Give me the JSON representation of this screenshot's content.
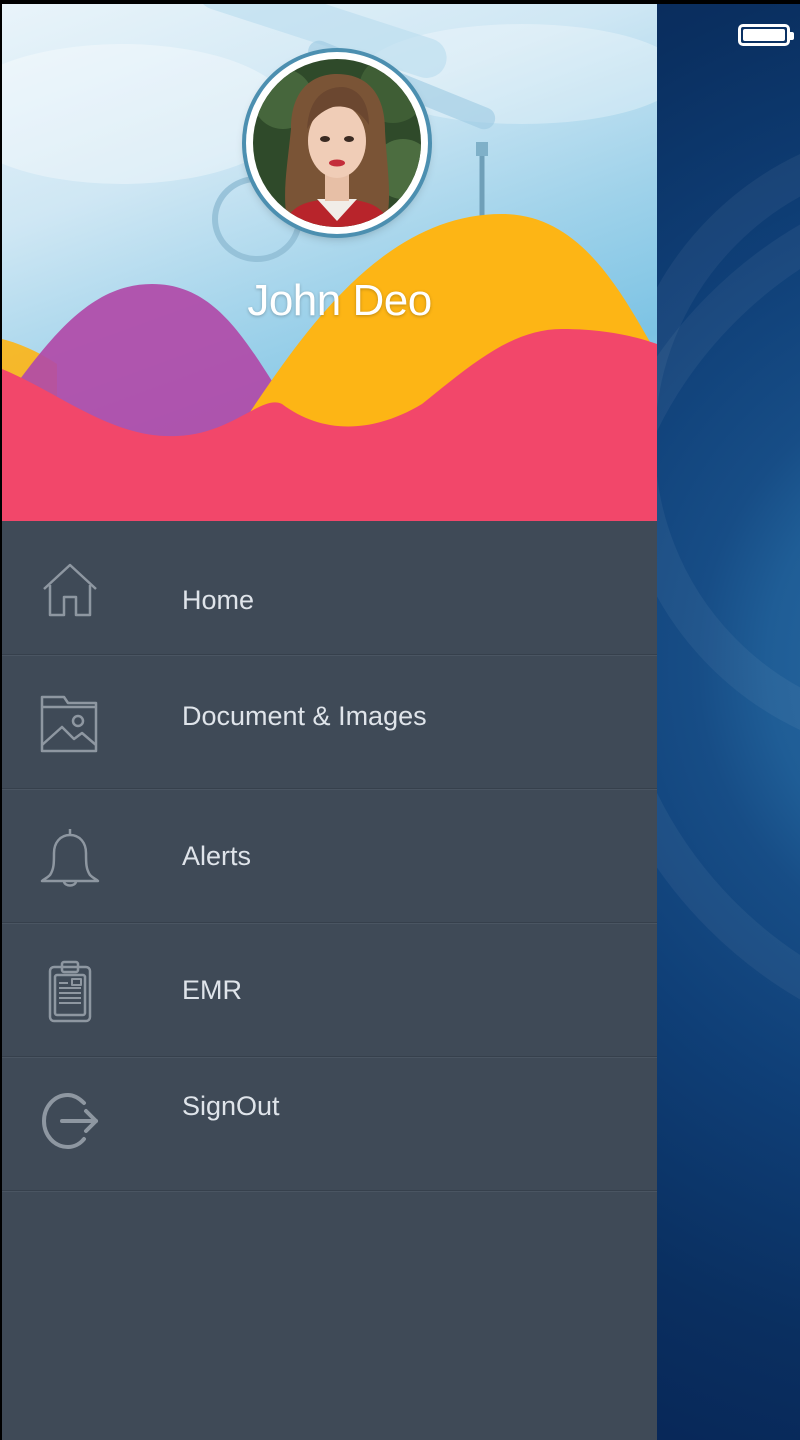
{
  "profile": {
    "name": "John Deo"
  },
  "menu": {
    "items": [
      {
        "label": "Home",
        "icon": "home-icon"
      },
      {
        "label": "Document & Images",
        "icon": "folder-image-icon"
      },
      {
        "label": "Alerts",
        "icon": "bell-icon"
      },
      {
        "label": "EMR",
        "icon": "clipboard-icon"
      },
      {
        "label": "SignOut",
        "icon": "signout-icon"
      }
    ]
  },
  "colors": {
    "drawer_bg": "#3f4a57",
    "wave_red": "#f2476a",
    "wave_yellow": "#fdb515",
    "wave_purple": "#b04aa8",
    "icon_gray": "#8e97a1",
    "text_light": "#dfe4ea"
  }
}
